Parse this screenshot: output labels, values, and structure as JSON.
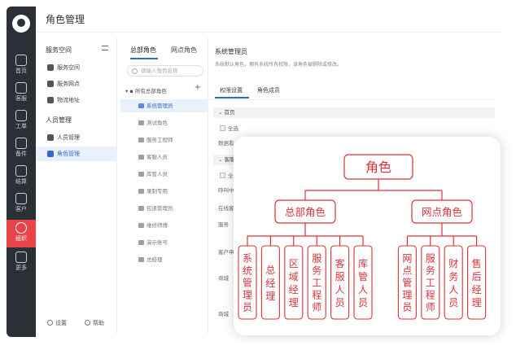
{
  "app": {
    "page_title": "角色管理"
  },
  "rail": {
    "items": [
      {
        "label": "首页"
      },
      {
        "label": "客服"
      },
      {
        "label": "工单"
      },
      {
        "label": "备件"
      },
      {
        "label": "结算"
      },
      {
        "label": "客户"
      },
      {
        "label": "组织"
      },
      {
        "label": "更多"
      }
    ],
    "active_index": 6,
    "accent": "#e8454b"
  },
  "sidebar": {
    "group1": "服务空间",
    "group1_items": [
      "服务空间",
      "服务网点",
      "物流地址"
    ],
    "group2": "人员管理",
    "group2_items": [
      "人员管理",
      "角色管理"
    ],
    "active_item": "角色管理",
    "footer_settings": "设置",
    "footer_help": "帮助"
  },
  "tree": {
    "tabs": [
      "总部角色",
      "网点角色"
    ],
    "search_placeholder": "请输入角色名称",
    "root_label": "所有总部角色",
    "add_label": "+",
    "nodes": [
      "系统管理员",
      "测试角色",
      "服务工程师",
      "客服人员",
      "库管人员",
      "录制专用",
      "包退管理员",
      "维修师傅",
      "演示账号",
      "总经理"
    ],
    "active_node": "系统管理员"
  },
  "detail": {
    "title": "系统管理员",
    "description": "系统默认角色，拥有系统所有权限，该角色被删除或修改。",
    "tabs": [
      "权限设置",
      "角色成员"
    ],
    "sections": [
      {
        "label": "首页",
        "check": "全选",
        "rows": [
          "数据看"
        ]
      },
      {
        "label": "客服",
        "check": "全",
        "rows": [
          "呼叫中",
          "在线客",
          "服务"
        ]
      }
    ],
    "extra_rows": [
      "客户申",
      "商城",
      "商城"
    ]
  },
  "diagram": {
    "root": "角色",
    "branches": [
      {
        "label": "总部角色",
        "children": [
          "系统管理员",
          "总经理",
          "区域经理",
          "服务工程师",
          "客服人员",
          "库管人员"
        ]
      },
      {
        "label": "网点角色",
        "children": [
          "网点管理员",
          "服务工程师",
          "财务人员",
          "售后经理"
        ]
      }
    ],
    "color": "#d9333a"
  }
}
